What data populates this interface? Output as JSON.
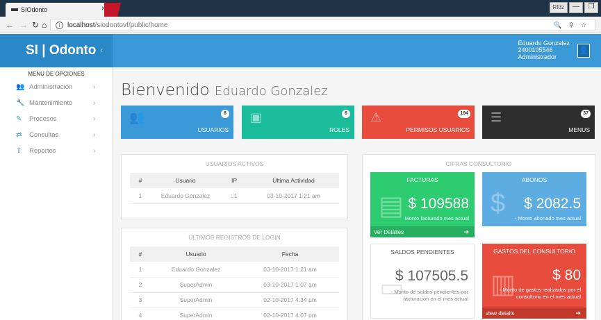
{
  "browser": {
    "tab_title": "SIOdonto",
    "tab_close": "×",
    "window_user": "Rfdz",
    "minimize": "—",
    "maximize": "❐",
    "url_host": "localhost",
    "url_path": "/siodontovf/public/home",
    "url_icons": "🔍 ⚲ ☆"
  },
  "header": {
    "logo": "SI | Odonto",
    "toggle_icon": "‹",
    "user_name": "Eduardo Gonzalez",
    "user_id": "2400105546",
    "user_role": "Administrador"
  },
  "sidebar": {
    "title": "MENU DE OPCIONES",
    "items": [
      {
        "label": "Administración",
        "icon": "users-icon"
      },
      {
        "label": "Mantenimiento",
        "icon": "wrench-icon"
      },
      {
        "label": "Procesos",
        "icon": "edit-icon"
      },
      {
        "label": "Consultas",
        "icon": "exchange-icon"
      },
      {
        "label": "Reportes",
        "icon": "upload-icon"
      }
    ]
  },
  "main": {
    "welcome": "Bienvenido",
    "welcome_name": "Eduardo Gonzalez",
    "tiles": [
      {
        "label": "USUARIOS",
        "badge": "6",
        "color": "#3b99d8"
      },
      {
        "label": "ROLES",
        "badge": "6",
        "color": "#1bbc9b"
      },
      {
        "label": "PERMISOS USUARIOS",
        "badge": "194",
        "color": "#e74c3c"
      },
      {
        "label": "MENUS",
        "badge": "37",
        "color": "#2e2e2e"
      }
    ],
    "active_users": {
      "title": "USUARIOS ACTIVOS",
      "headers": [
        "#",
        "Usuario",
        "IP",
        "Última Actividad"
      ],
      "rows": [
        [
          "1",
          "Eduardo Gonzalez",
          "::1",
          "03-10-2017 1:21 am"
        ]
      ]
    },
    "login_log": {
      "title": "ULTIMOS REGISTROS DE LOGIN",
      "headers": [
        "#",
        "Usuario",
        "Fecha"
      ],
      "rows": [
        [
          "1",
          "Eduardo Gonzalez",
          "03-10-2017 1:21 am"
        ],
        [
          "2",
          "SuperAdmin",
          "03-10-2017 1:07 am"
        ],
        [
          "3",
          "SuperAdmin",
          "02-10-2017 4:34 pm"
        ],
        [
          "4",
          "SuperAdmin",
          "02-10-2017 4:07 pm"
        ]
      ]
    },
    "figures": {
      "title": "CIFRAS CONSULTORIO",
      "facturas": {
        "title": "FACTURAS",
        "value": "$ 109588",
        "desc": "Monto facturado mes actual",
        "link": "Ver Detalles",
        "color": "#2ecc71"
      },
      "abonos": {
        "title": "ABONOS",
        "value": "$ 2082.5",
        "desc": "- Monto abonado mes actual",
        "color": "#5dade2"
      },
      "saldos": {
        "title": "SALDOS PENDIENTES",
        "value": "$ 107505.5",
        "desc1": "- Monto de saldos pendientes por",
        "desc2": "facturación en el mes actual"
      },
      "gastos": {
        "title": "GASTOS DEL CONSULTORIO",
        "value": "$ 80",
        "desc1": "- Monto de gastos realizados por el",
        "desc2": "consultorio en el mes actual",
        "link": "view details",
        "color": "#e74c3c"
      }
    }
  }
}
